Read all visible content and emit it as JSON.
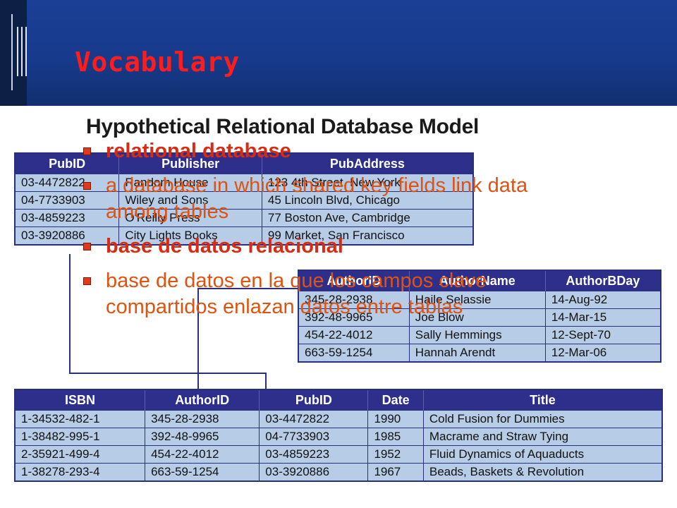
{
  "slide": {
    "title": "Vocabulary",
    "accent_color": "#ff1c1c",
    "header_color": "#173a8c"
  },
  "figure": {
    "title": "Hypothetical Relational Database Model",
    "publishers": {
      "headers": [
        "PubID",
        "Publisher",
        "PubAddress"
      ],
      "rows": [
        [
          "03-4472822",
          "Random House",
          "123 4th Street, New York"
        ],
        [
          "04-7733903",
          "Wiley and Sons",
          "45 Lincoln Blvd, Chicago"
        ],
        [
          "03-4859223",
          "O'Reilly Press",
          "77 Boston Ave, Cambridge"
        ],
        [
          "03-3920886",
          "City Lights Books",
          "99 Market, San Francisco"
        ]
      ]
    },
    "authors": {
      "headers": [
        "AuthorID",
        "AuthorName",
        "AuthorBDay"
      ],
      "rows": [
        [
          "345-28-2938",
          "Haile Selassie",
          "14-Aug-92"
        ],
        [
          "392-48-9965",
          "Joe Blow",
          "14-Mar-15"
        ],
        [
          "454-22-4012",
          "Sally Hemmings",
          "12-Sept-70"
        ],
        [
          "663-59-1254",
          "Hannah Arendt",
          "12-Mar-06"
        ]
      ]
    },
    "books": {
      "headers": [
        "ISBN",
        "AuthorID",
        "PubID",
        "Date",
        "Title"
      ],
      "rows": [
        [
          "1-34532-482-1",
          "345-28-2938",
          "03-4472822",
          "1990",
          "Cold Fusion for Dummies"
        ],
        [
          "1-38482-995-1",
          "392-48-9965",
          "04-7733903",
          "1985",
          "Macrame and Straw Tying"
        ],
        [
          "2-35921-499-4",
          "454-22-4012",
          "03-4859223",
          "1952",
          "Fluid Dynamics of Aquaducts"
        ],
        [
          "1-38278-293-4",
          "663-59-1254",
          "03-3920886",
          "1967",
          "Beads, Baskets & Revolution"
        ]
      ]
    },
    "table_header_color": "#2d2f8a",
    "table_cell_color": "#b7cce6"
  },
  "bullets": [
    {
      "text": "relational database",
      "style": "term",
      "color": "#d92a14"
    },
    {
      "text": "a database in which shared key fields link data among tables",
      "style": "def",
      "color": "#e0520f"
    },
    {
      "text": "base de datos relacional",
      "style": "term",
      "color": "#d92a14"
    },
    {
      "text": "base de datos en la que los campos clave compartidos enlazan datos entre tablas",
      "style": "def",
      "color": "#e0520f"
    }
  ]
}
